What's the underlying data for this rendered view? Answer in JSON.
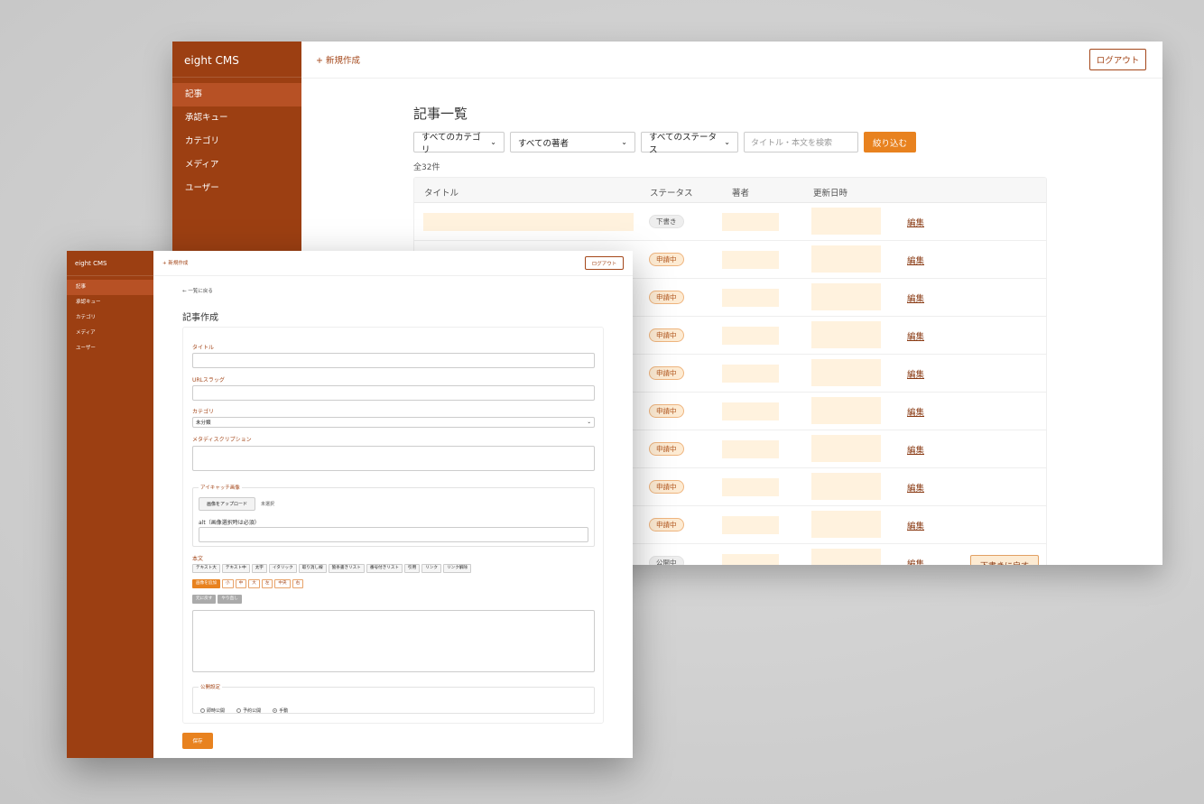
{
  "back_window": {
    "brand": "eight CMS",
    "nav": [
      "記事",
      "承認キュー",
      "カテゴリ",
      "メディア",
      "ユーザー"
    ],
    "new_link": "+ 新規作成",
    "logout": "ログアウト",
    "title": "記事一覧",
    "filters": {
      "category": "すべてのカテゴリ",
      "author": "すべての著者",
      "status": "すべてのステータス",
      "search_placeholder": "タイトル・本文を検索",
      "button": "絞り込む"
    },
    "count": "全32件",
    "columns": [
      "タイトル",
      "ステータス",
      "著者",
      "更新日時"
    ],
    "rows": [
      {
        "status": "下書き",
        "status_type": "draft",
        "edit": "編集"
      },
      {
        "status": "申請中",
        "status_type": "pending",
        "edit": "編集"
      },
      {
        "status": "申請中",
        "status_type": "pending",
        "edit": "編集"
      },
      {
        "status": "申請中",
        "status_type": "pending",
        "edit": "編集"
      },
      {
        "status": "申請中",
        "status_type": "pending",
        "edit": "編集"
      },
      {
        "status": "申請中",
        "status_type": "pending",
        "edit": "編集"
      },
      {
        "status": "申請中",
        "status_type": "pending",
        "edit": "編集"
      },
      {
        "status": "申請中",
        "status_type": "pending",
        "edit": "編集"
      },
      {
        "status": "申請中",
        "status_type": "pending",
        "edit": "編集"
      },
      {
        "status": "公開中",
        "status_type": "published",
        "edit": "編集",
        "action": "下書きに戻す"
      }
    ]
  },
  "front_window": {
    "brand": "eight CMS",
    "nav": [
      "記事",
      "承認キュー",
      "カテゴリ",
      "メディア",
      "ユーザー"
    ],
    "new_link": "+ 新規作成",
    "logout": "ログアウト",
    "back_link": "← 一覧に戻る",
    "title": "記事作成",
    "labels": {
      "title": "タイトル",
      "slug": "URLスラッグ",
      "category": "カテゴリ",
      "meta": "メタディスクリプション",
      "eyecatch": "アイキャッチ画像",
      "alt": "alt（画像選択時は必須）",
      "body": "本文",
      "publish": "公開設定"
    },
    "category_value": "未分類",
    "upload_button": "画像をアップロード",
    "no_file": "未選択",
    "toolbar1": [
      "テキスト大",
      "テキスト中",
      "太字",
      "イタリック",
      "取り消し線",
      "箇条書きリスト",
      "番号付きリスト",
      "引用",
      "リンク",
      "リンク解除"
    ],
    "toolbar2_add": "画像を追加",
    "toolbar2": [
      "小",
      "中",
      "大",
      "左",
      "中央",
      "右"
    ],
    "toolbar3": [
      "元に戻す",
      "やり直し"
    ],
    "publish_options": [
      "即時公開",
      "予約公開",
      "手動"
    ],
    "publish_selected": "手動",
    "save": "保存"
  },
  "colors": {
    "sidebar": "#9c3f12",
    "sidebar_active": "#b75125",
    "accent": "#e8821f",
    "link": "#a4471a",
    "placeholder_fill": "#fff2de"
  }
}
